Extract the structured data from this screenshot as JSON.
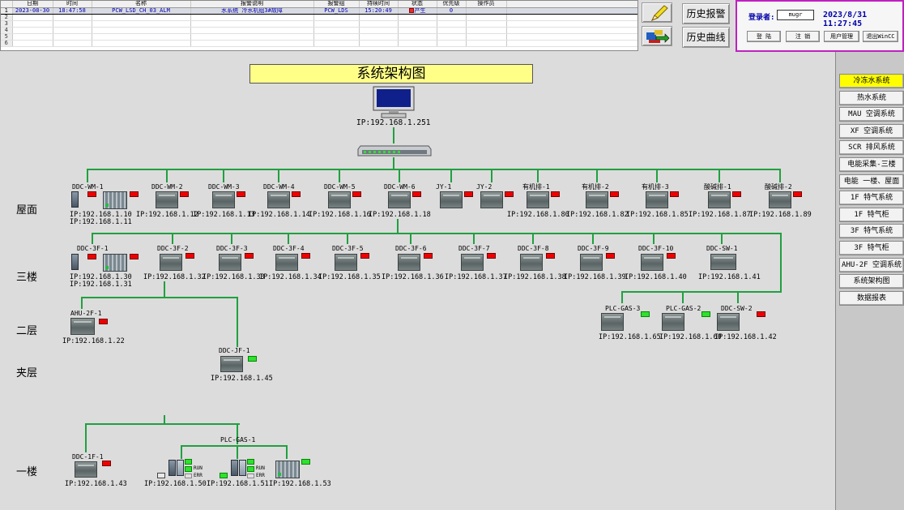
{
  "alarm_table": {
    "headers": [
      "日期",
      "时间",
      "名称",
      "报警说明",
      "报警组",
      "持续时间",
      "状态",
      "优先级",
      "操作员"
    ],
    "rows": [
      [
        "2023-08-30",
        "18:47:58",
        "PCW_LSD_CH_03_ALM",
        "水系统 冷水机组3#故障",
        "PCW_LDS",
        "15:20:49",
        "产生",
        "0",
        ""
      ],
      [
        "",
        "",
        "",
        "",
        "",
        "",
        "",
        "",
        ""
      ],
      [
        "",
        "",
        "",
        "",
        "",
        "",
        "",
        "",
        ""
      ],
      [
        "",
        "",
        "",
        "",
        "",
        "",
        "",
        "",
        ""
      ],
      [
        "",
        "",
        "",
        "",
        "",
        "",
        "",
        "",
        ""
      ],
      [
        "",
        "",
        "",
        "",
        "",
        "",
        "",
        "",
        ""
      ]
    ],
    "row_numbers": [
      "1",
      "2",
      "3",
      "4",
      "5",
      "6"
    ]
  },
  "toolbar": {
    "history_alarm_label": "历史报警",
    "history_curve_label": "历史曲线",
    "ack_icon": "pencil-icon",
    "export_icon": "export-icon"
  },
  "login": {
    "user_label": "登录者:",
    "user_value": "mugr",
    "datetime": "2023/8/31 11:27:45",
    "buttons": [
      "登 陆",
      "注 销",
      "用户管理",
      "退出WinCC"
    ]
  },
  "nav": {
    "items": [
      "冷冻水系统",
      "热水系统",
      "MAU 空调系统",
      "XF 空调系统",
      "SCR 排风系统",
      "电能采集-三楼",
      "电能 一楼、屋面",
      "1F 特气系统",
      "1F 特气柜",
      "3F 特气系统",
      "3F 特气柜",
      "AHU-2F 空调系统",
      "系统架构图",
      "数据报表"
    ],
    "active_index": 0,
    "active_color": "#ffff00"
  },
  "diagram": {
    "title": "系统架构图",
    "server_ip": "IP:192.168.1.251",
    "floors": [
      "屋面",
      "三楼",
      "二层",
      "夹层",
      "一楼"
    ],
    "status_colors": {
      "alarm": "#ee0000",
      "ok": "#30e030"
    },
    "roof_devices": [
      {
        "name": "DDC-WM-1",
        "ip": "IP:192.168.1.10",
        "ip2": "IP:192.168.1.11",
        "status": "alarm"
      },
      {
        "name": "DDC-WM-2",
        "ip": "IP:192.168.1.12",
        "status": "alarm"
      },
      {
        "name": "DDC-WM-3",
        "ip": "IP:192.168.1.13",
        "status": "alarm"
      },
      {
        "name": "DDC-WM-4",
        "ip": "IP:192.168.1.14",
        "status": "alarm"
      },
      {
        "name": "DDC-WM-5",
        "ip": "IP:192.168.1.16",
        "status": "alarm"
      },
      {
        "name": "DDC-WM-6",
        "ip": "IP:192.168.1.18",
        "status": "alarm"
      },
      {
        "name": "JY-1",
        "ip": "",
        "status": "alarm"
      },
      {
        "name": "JY-2",
        "ip": "",
        "status": "alarm"
      },
      {
        "name": "有机排-1",
        "ip": "IP:192.168.1.80",
        "status": "alarm"
      },
      {
        "name": "有机排-2",
        "ip": "IP:192.168.1.82",
        "status": "alarm"
      },
      {
        "name": "有机排-3",
        "ip": "IP:192.168.1.85",
        "status": "alarm"
      },
      {
        "name": "酸碱排-1",
        "ip": "IP:192.168.1.87",
        "status": "alarm"
      },
      {
        "name": "酸碱排-2",
        "ip": "IP:192.168.1.89",
        "status": "alarm"
      }
    ],
    "f3_devices": [
      {
        "name": "DDC-3F-1",
        "ip": "IP:192.168.1.30",
        "ip2": "IP:192.168.1.31",
        "status": "alarm"
      },
      {
        "name": "DDC-3F-2",
        "ip": "IP:192.168.1.32",
        "status": "alarm"
      },
      {
        "name": "DDC-3F-3",
        "ip": "IP:192.168.1.33",
        "status": "alarm"
      },
      {
        "name": "DDC-3F-4",
        "ip": "IP:192.168.1.34",
        "status": "alarm"
      },
      {
        "name": "DDC-3F-5",
        "ip": "IP:192.168.1.35",
        "status": "alarm"
      },
      {
        "name": "DDC-3F-6",
        "ip": "IP:192.168.1.36",
        "status": "alarm"
      },
      {
        "name": "DDC-3F-7",
        "ip": "IP:192.168.1.37",
        "status": "alarm"
      },
      {
        "name": "DDC-3F-8",
        "ip": "IP:192.168.1.38",
        "status": "alarm"
      },
      {
        "name": "DDC-3F-9",
        "ip": "IP:192.168.1.39",
        "status": "alarm"
      },
      {
        "name": "DDC-3F-10",
        "ip": "IP:192.168.1.40",
        "status": "alarm"
      },
      {
        "name": "DDC-SW-1",
        "ip": "IP:192.168.1.41",
        "status": "none"
      }
    ],
    "gas_devices": [
      {
        "name": "PLC-GAS-3",
        "ip": "IP:192.168.1.65",
        "status": "ok"
      },
      {
        "name": "PLC-GAS-2",
        "ip": "IP:192.168.1.60",
        "status": "ok"
      },
      {
        "name": "DDC-SW-2",
        "ip": "IP:192.168.1.42",
        "status": "alarm"
      }
    ],
    "f2_devices": [
      {
        "name": "AHU-2F-1",
        "ip": "IP:192.168.1.22",
        "status": "alarm"
      }
    ],
    "mezz_devices": [
      {
        "name": "DDC-JF-1",
        "ip": "IP:192.168.1.45",
        "status": "ok"
      }
    ],
    "f1_devices": [
      {
        "name": "DDC-1F-1",
        "ip": "IP:192.168.1.43",
        "status": "alarm"
      }
    ],
    "plc_gas_1": {
      "name": "PLC-GAS-1",
      "ips": [
        "IP:192.168.1.50",
        "IP:192.168.1.51",
        "IP:192.168.1.53"
      ],
      "run_label": "RUN",
      "err_label": "ERR"
    }
  }
}
